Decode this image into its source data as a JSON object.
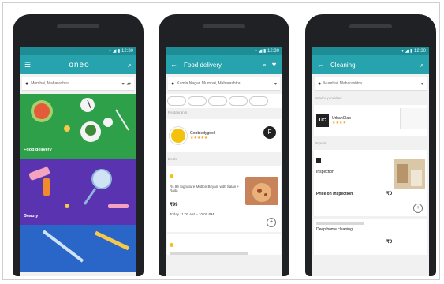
{
  "phones": [
    {
      "status": "▾ ◢ ▮ 12:30",
      "app_title": "oneo",
      "location": "Mumbai, Maharashtra",
      "tiles": [
        {
          "label": "Food delivery",
          "color": "#2fa04a"
        },
        {
          "label": "Beauty",
          "color": "#5a34b0"
        },
        {
          "label": "",
          "color": "#2a66c8"
        }
      ]
    },
    {
      "status": "▾ ◢ ▮ 12:30",
      "app_title": "Food delivery",
      "location": "Kamla Nagar, Mumbai, Maharashtra",
      "section1": "Restaurants",
      "card1_name": "Gobbledygook",
      "card1_rating": "★★★★★",
      "section2": "Deals",
      "deal_title": "Rs.99 Signature Mutton Biryani with Salan + Raita",
      "deal_price": "₹99",
      "deal_meta": "Today 11:00 AM – 10:00 PM",
      "fab": "+"
    },
    {
      "status": "▾ ◢ ▮ 12:30",
      "app_title": "Cleaning",
      "location": "Mumbai, Maharashtra",
      "section1": "Service providers",
      "card1_logo": "UC",
      "card1_name": "UrbanClap",
      "card1_rating": "★★★★",
      "section2": "Popular",
      "item1_title": "Inspection",
      "item1_sub": "Price on inspection",
      "item1_price": "₹0",
      "item2_title": "Deep home cleaning",
      "item2_price": "₹0",
      "fab": "+"
    }
  ],
  "icons": [
    "menu-icon",
    "search-icon",
    "pin-icon",
    "cart-icon",
    "back-icon",
    "filter-icon"
  ]
}
